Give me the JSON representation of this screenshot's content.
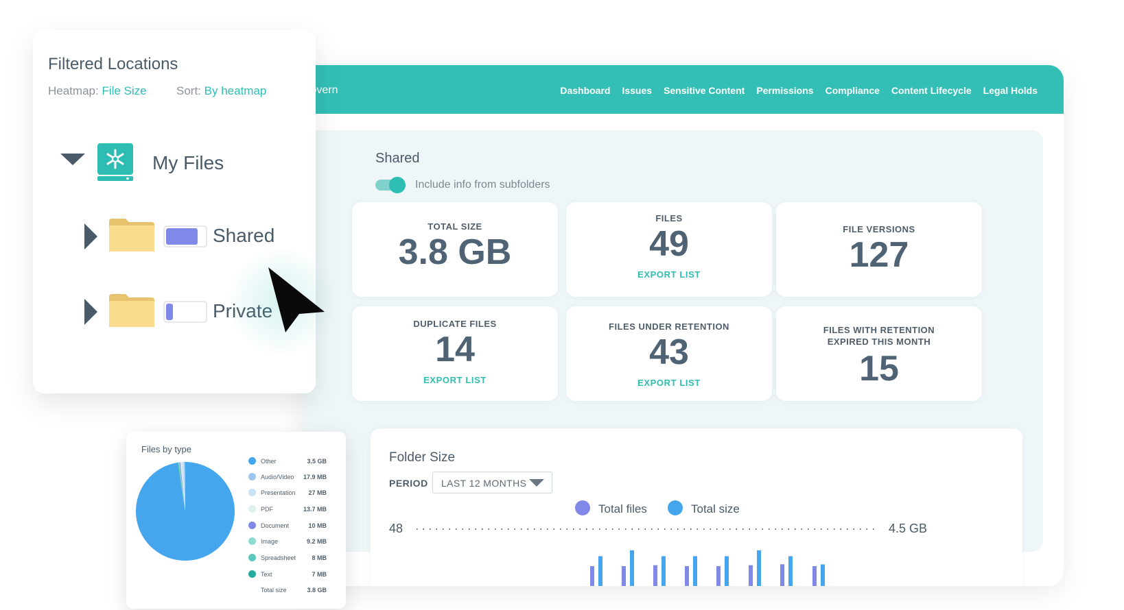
{
  "app": {
    "brand": "Govern",
    "nav": [
      "Dashboard",
      "Issues",
      "Sensitive Content",
      "Permissions",
      "Compliance",
      "Content Lifecycle",
      "Legal Holds"
    ]
  },
  "locations": {
    "title": "Filtered Locations",
    "heatmap_label": "Heatmap:",
    "heatmap_value": "File Size",
    "sort_label": "Sort:",
    "sort_value": "By heatmap",
    "root": "My Files",
    "children": [
      {
        "name": "Shared",
        "heat_fraction": 0.82
      },
      {
        "name": "Private",
        "heat_fraction": 0.18
      }
    ]
  },
  "folder": {
    "title": "Shared",
    "toggle_label": "Include info from subfolders",
    "toggle_on": true
  },
  "stats": [
    {
      "label": "TOTAL SIZE",
      "value": "3.8 GB",
      "link": ""
    },
    {
      "label": "FILES",
      "value": "49",
      "link": "EXPORT LIST"
    },
    {
      "label": "FILE VERSIONS",
      "value": "127",
      "link": ""
    },
    {
      "label": "DUPLICATE FILES",
      "value": "14",
      "link": "EXPORT LIST"
    },
    {
      "label": "FILES UNDER RETENTION",
      "value": "43",
      "link": "EXPORT LIST"
    },
    {
      "label": "FILES WITH RETENTION EXPIRED THIS MONTH",
      "value": "15",
      "link": ""
    }
  ],
  "folder_size": {
    "title": "Folder Size",
    "period_label": "PERIOD",
    "period_value": "LAST 12 MONTHS",
    "legend": [
      "Total files",
      "Total size"
    ],
    "left_axis_max": "48",
    "right_axis_max": "4.5 GB",
    "colors": {
      "files": "#8088e8",
      "size": "#45a6ee"
    }
  },
  "pie": {
    "title": "Files by type",
    "total_label": "Total size",
    "total_value": "3.8 GB",
    "items": [
      {
        "name": "Other",
        "value": "3.5 GB",
        "mb": 3500,
        "color": "#45a6ee"
      },
      {
        "name": "Audio/Video",
        "value": "17.9 MB",
        "mb": 17.9,
        "color": "#9cc6ee"
      },
      {
        "name": "Presentation",
        "value": "27 MB",
        "mb": 27,
        "color": "#c8e2f6"
      },
      {
        "name": "PDF",
        "value": "13.7 MB",
        "mb": 13.7,
        "color": "#dff0ee"
      },
      {
        "name": "Document",
        "value": "10 MB",
        "mb": 10,
        "color": "#8088e8"
      },
      {
        "name": "Image",
        "value": "9.2 MB",
        "mb": 9.2,
        "color": "#8edcd0"
      },
      {
        "name": "Spreadsheet",
        "value": "8 MB",
        "mb": 8,
        "color": "#5cc9bc"
      },
      {
        "name": "Text",
        "value": "7 MB",
        "mb": 7,
        "color": "#28aa9c"
      }
    ]
  },
  "chart_data": {
    "type": "bar",
    "title": "Folder Size",
    "categories": [
      "",
      "",
      "",
      "",
      "",
      "",
      "",
      ""
    ],
    "series": [
      {
        "name": "Total files",
        "values": [
          40,
          40,
          41,
          40,
          40,
          41,
          42,
          40
        ]
      },
      {
        "name": "Total size",
        "values": [
          4.0,
          4.5,
          4.0,
          4.0,
          4.0,
          4.5,
          4.0,
          3.3
        ]
      }
    ],
    "y_left_max": 48,
    "y_right_max": 4.5,
    "y_right_unit": "GB"
  }
}
